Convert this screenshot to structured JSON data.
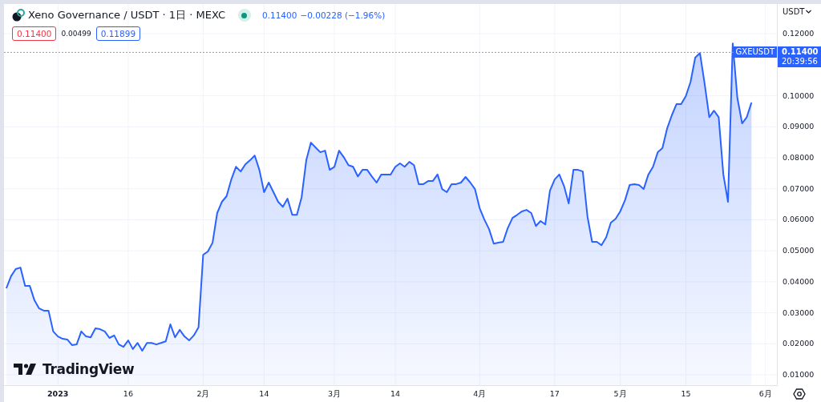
{
  "legend": {
    "symbol": "Xeno Governance / USDT · 1日 · MEXC",
    "last": "0.11400",
    "change": "−0.00228 (−1.96%)",
    "bid": "0.11400",
    "spread": "0.00499",
    "ask": "0.11899"
  },
  "price_scale": {
    "currency": "USDT"
  },
  "price_tag": {
    "countdown": "20:39:56"
  },
  "brand": "TradingView",
  "chart_data": {
    "type": "area",
    "x": [
      "2022-12-21",
      "2022-12-22",
      "2022-12-23",
      "2022-12-24",
      "2022-12-25",
      "2022-12-26",
      "2022-12-27",
      "2022-12-28",
      "2022-12-29",
      "2022-12-30",
      "2022-12-31",
      "2023-01-01",
      "2023-01-02",
      "2023-01-03",
      "2023-01-04",
      "2023-01-05",
      "2023-01-06",
      "2023-01-07",
      "2023-01-08",
      "2023-01-09",
      "2023-01-10",
      "2023-01-11",
      "2023-01-12",
      "2023-01-13",
      "2023-01-14",
      "2023-01-15",
      "2023-01-16",
      "2023-01-17",
      "2023-01-18",
      "2023-01-19",
      "2023-01-20",
      "2023-01-21",
      "2023-01-22",
      "2023-01-23",
      "2023-01-24",
      "2023-01-25",
      "2023-01-26",
      "2023-01-27",
      "2023-01-28",
      "2023-01-29",
      "2023-01-30",
      "2023-01-31",
      "2023-02-01",
      "2023-02-02",
      "2023-02-03",
      "2023-02-04",
      "2023-02-05",
      "2023-02-06",
      "2023-02-07",
      "2023-02-08",
      "2023-02-09",
      "2023-02-10",
      "2023-02-11",
      "2023-02-12",
      "2023-02-13",
      "2023-02-14",
      "2023-02-15",
      "2023-02-16",
      "2023-02-17",
      "2023-02-18",
      "2023-02-19",
      "2023-02-20",
      "2023-02-21",
      "2023-02-22",
      "2023-02-23",
      "2023-02-24",
      "2023-02-25",
      "2023-02-26",
      "2023-02-27",
      "2023-02-28",
      "2023-03-01",
      "2023-03-02",
      "2023-03-03",
      "2023-03-04",
      "2023-03-05",
      "2023-03-06",
      "2023-03-07",
      "2023-03-08",
      "2023-03-09",
      "2023-03-10",
      "2023-03-11",
      "2023-03-12",
      "2023-03-13",
      "2023-03-14",
      "2023-03-15",
      "2023-03-16",
      "2023-03-17",
      "2023-03-18",
      "2023-03-19",
      "2023-03-20",
      "2023-03-21",
      "2023-03-22",
      "2023-03-23",
      "2023-03-24",
      "2023-03-25",
      "2023-03-26",
      "2023-03-27",
      "2023-03-28",
      "2023-03-29",
      "2023-03-30",
      "2023-03-31",
      "2023-04-01",
      "2023-04-02",
      "2023-04-03",
      "2023-04-04",
      "2023-04-05",
      "2023-04-06",
      "2023-04-07",
      "2023-04-08",
      "2023-04-09",
      "2023-04-10",
      "2023-04-11",
      "2023-04-12",
      "2023-04-13",
      "2023-04-14",
      "2023-04-15",
      "2023-04-16",
      "2023-04-17",
      "2023-04-18",
      "2023-04-19",
      "2023-04-20",
      "2023-04-21",
      "2023-04-22",
      "2023-04-23",
      "2023-04-24",
      "2023-04-25",
      "2023-04-26",
      "2023-04-27",
      "2023-04-28",
      "2023-04-29",
      "2023-04-30",
      "2023-05-01",
      "2023-05-02",
      "2023-05-03",
      "2023-05-04",
      "2023-05-05",
      "2023-05-06",
      "2023-05-07",
      "2023-05-08",
      "2023-05-09",
      "2023-05-10",
      "2023-05-11",
      "2023-05-12",
      "2023-05-13",
      "2023-05-14",
      "2023-05-15",
      "2023-05-16",
      "2023-05-17",
      "2023-05-18",
      "2023-05-19",
      "2023-05-20",
      "2023-05-21",
      "2023-05-22",
      "2023-05-23",
      "2023-05-24",
      "2023-05-25",
      "2023-05-26",
      "2023-05-27",
      "2023-05-28",
      "2023-05-29"
    ],
    "series": [
      {
        "name": "GXEUSDT",
        "color": "#2962ff",
        "values": [
          0.0379,
          0.0418,
          0.0441,
          0.0446,
          0.0387,
          0.0387,
          0.034,
          0.0314,
          0.0307,
          0.0307,
          0.024,
          0.0224,
          0.0216,
          0.0214,
          0.0196,
          0.0198,
          0.024,
          0.0224,
          0.0221,
          0.025,
          0.0247,
          0.024,
          0.0219,
          0.0227,
          0.0198,
          0.019,
          0.0211,
          0.0183,
          0.0203,
          0.0178,
          0.0203,
          0.0203,
          0.0198,
          0.0203,
          0.0208,
          0.0263,
          0.0221,
          0.0245,
          0.0224,
          0.0211,
          0.0227,
          0.0253,
          0.0487,
          0.0498,
          0.0526,
          0.0622,
          0.0658,
          0.0676,
          0.073,
          0.0771,
          0.0756,
          0.0779,
          0.0792,
          0.0807,
          0.0761,
          0.0689,
          0.072,
          0.0689,
          0.0658,
          0.0642,
          0.0668,
          0.0616,
          0.0616,
          0.0673,
          0.0792,
          0.0849,
          0.0833,
          0.0818,
          0.0823,
          0.0761,
          0.0771,
          0.0823,
          0.0802,
          0.0776,
          0.0771,
          0.074,
          0.0761,
          0.0761,
          0.074,
          0.072,
          0.0746,
          0.0746,
          0.0746,
          0.0771,
          0.0782,
          0.0771,
          0.0787,
          0.0776,
          0.0715,
          0.0715,
          0.0725,
          0.0725,
          0.0746,
          0.0699,
          0.0689,
          0.0715,
          0.0715,
          0.072,
          0.0738,
          0.072,
          0.0699,
          0.0637,
          0.0601,
          0.057,
          0.0523,
          0.0526,
          0.0529,
          0.0573,
          0.0606,
          0.0616,
          0.0627,
          0.0632,
          0.0622,
          0.058,
          0.0596,
          0.0585,
          0.0694,
          0.073,
          0.0746,
          0.0709,
          0.0653,
          0.0761,
          0.0761,
          0.0756,
          0.0611,
          0.0529,
          0.0529,
          0.0518,
          0.0544,
          0.0591,
          0.0603,
          0.0627,
          0.0663,
          0.0712,
          0.0715,
          0.0712,
          0.0699,
          0.0746,
          0.0771,
          0.0818,
          0.0831,
          0.0895,
          0.0937,
          0.0973,
          0.0973,
          0.0999,
          0.1045,
          0.1123,
          0.1138,
          0.104,
          0.0931,
          0.0952,
          0.0931,
          0.0746,
          0.0658,
          0.1169,
          0.0993,
          0.0911,
          0.0931,
          0.0978
        ]
      }
    ],
    "xlim": [
      "2022-12-20",
      "2023-06-04"
    ],
    "ylim": [
      0.0064,
      0.1296
    ],
    "grid": true,
    "ref_lines": [
      {
        "axis": "y",
        "value": 0.114,
        "color": "#9598a1",
        "label": "0.11400"
      }
    ],
    "xticks": [
      {
        "value": "2023-01-01",
        "label": "2023"
      },
      {
        "value": "2023-01-16",
        "label": "16"
      },
      {
        "value": "2023-02-01",
        "label": "2月"
      },
      {
        "value": "2023-02-14",
        "label": "14"
      },
      {
        "value": "2023-03-01",
        "label": "3月"
      },
      {
        "value": "2023-03-14",
        "label": "14"
      },
      {
        "value": "2023-04-01",
        "label": "4月"
      },
      {
        "value": "2023-04-17",
        "label": "17"
      },
      {
        "value": "2023-05-01",
        "label": "5月"
      },
      {
        "value": "2023-05-15",
        "label": "15"
      },
      {
        "value": "2023-06-01",
        "label": "6月"
      }
    ],
    "yticks": [
      {
        "value": 0.12,
        "label": "0.12000"
      },
      {
        "value": 0.1,
        "label": "0.10000"
      },
      {
        "value": 0.09,
        "label": "0.09000"
      },
      {
        "value": 0.08,
        "label": "0.08000"
      },
      {
        "value": 0.07,
        "label": "0.07000"
      },
      {
        "value": 0.06,
        "label": "0.06000"
      },
      {
        "value": 0.05,
        "label": "0.05000"
      },
      {
        "value": 0.04,
        "label": "0.04000"
      },
      {
        "value": 0.03,
        "label": "0.03000"
      },
      {
        "value": 0.02,
        "label": "0.02000"
      },
      {
        "value": 0.01,
        "label": "0.01000"
      }
    ]
  }
}
